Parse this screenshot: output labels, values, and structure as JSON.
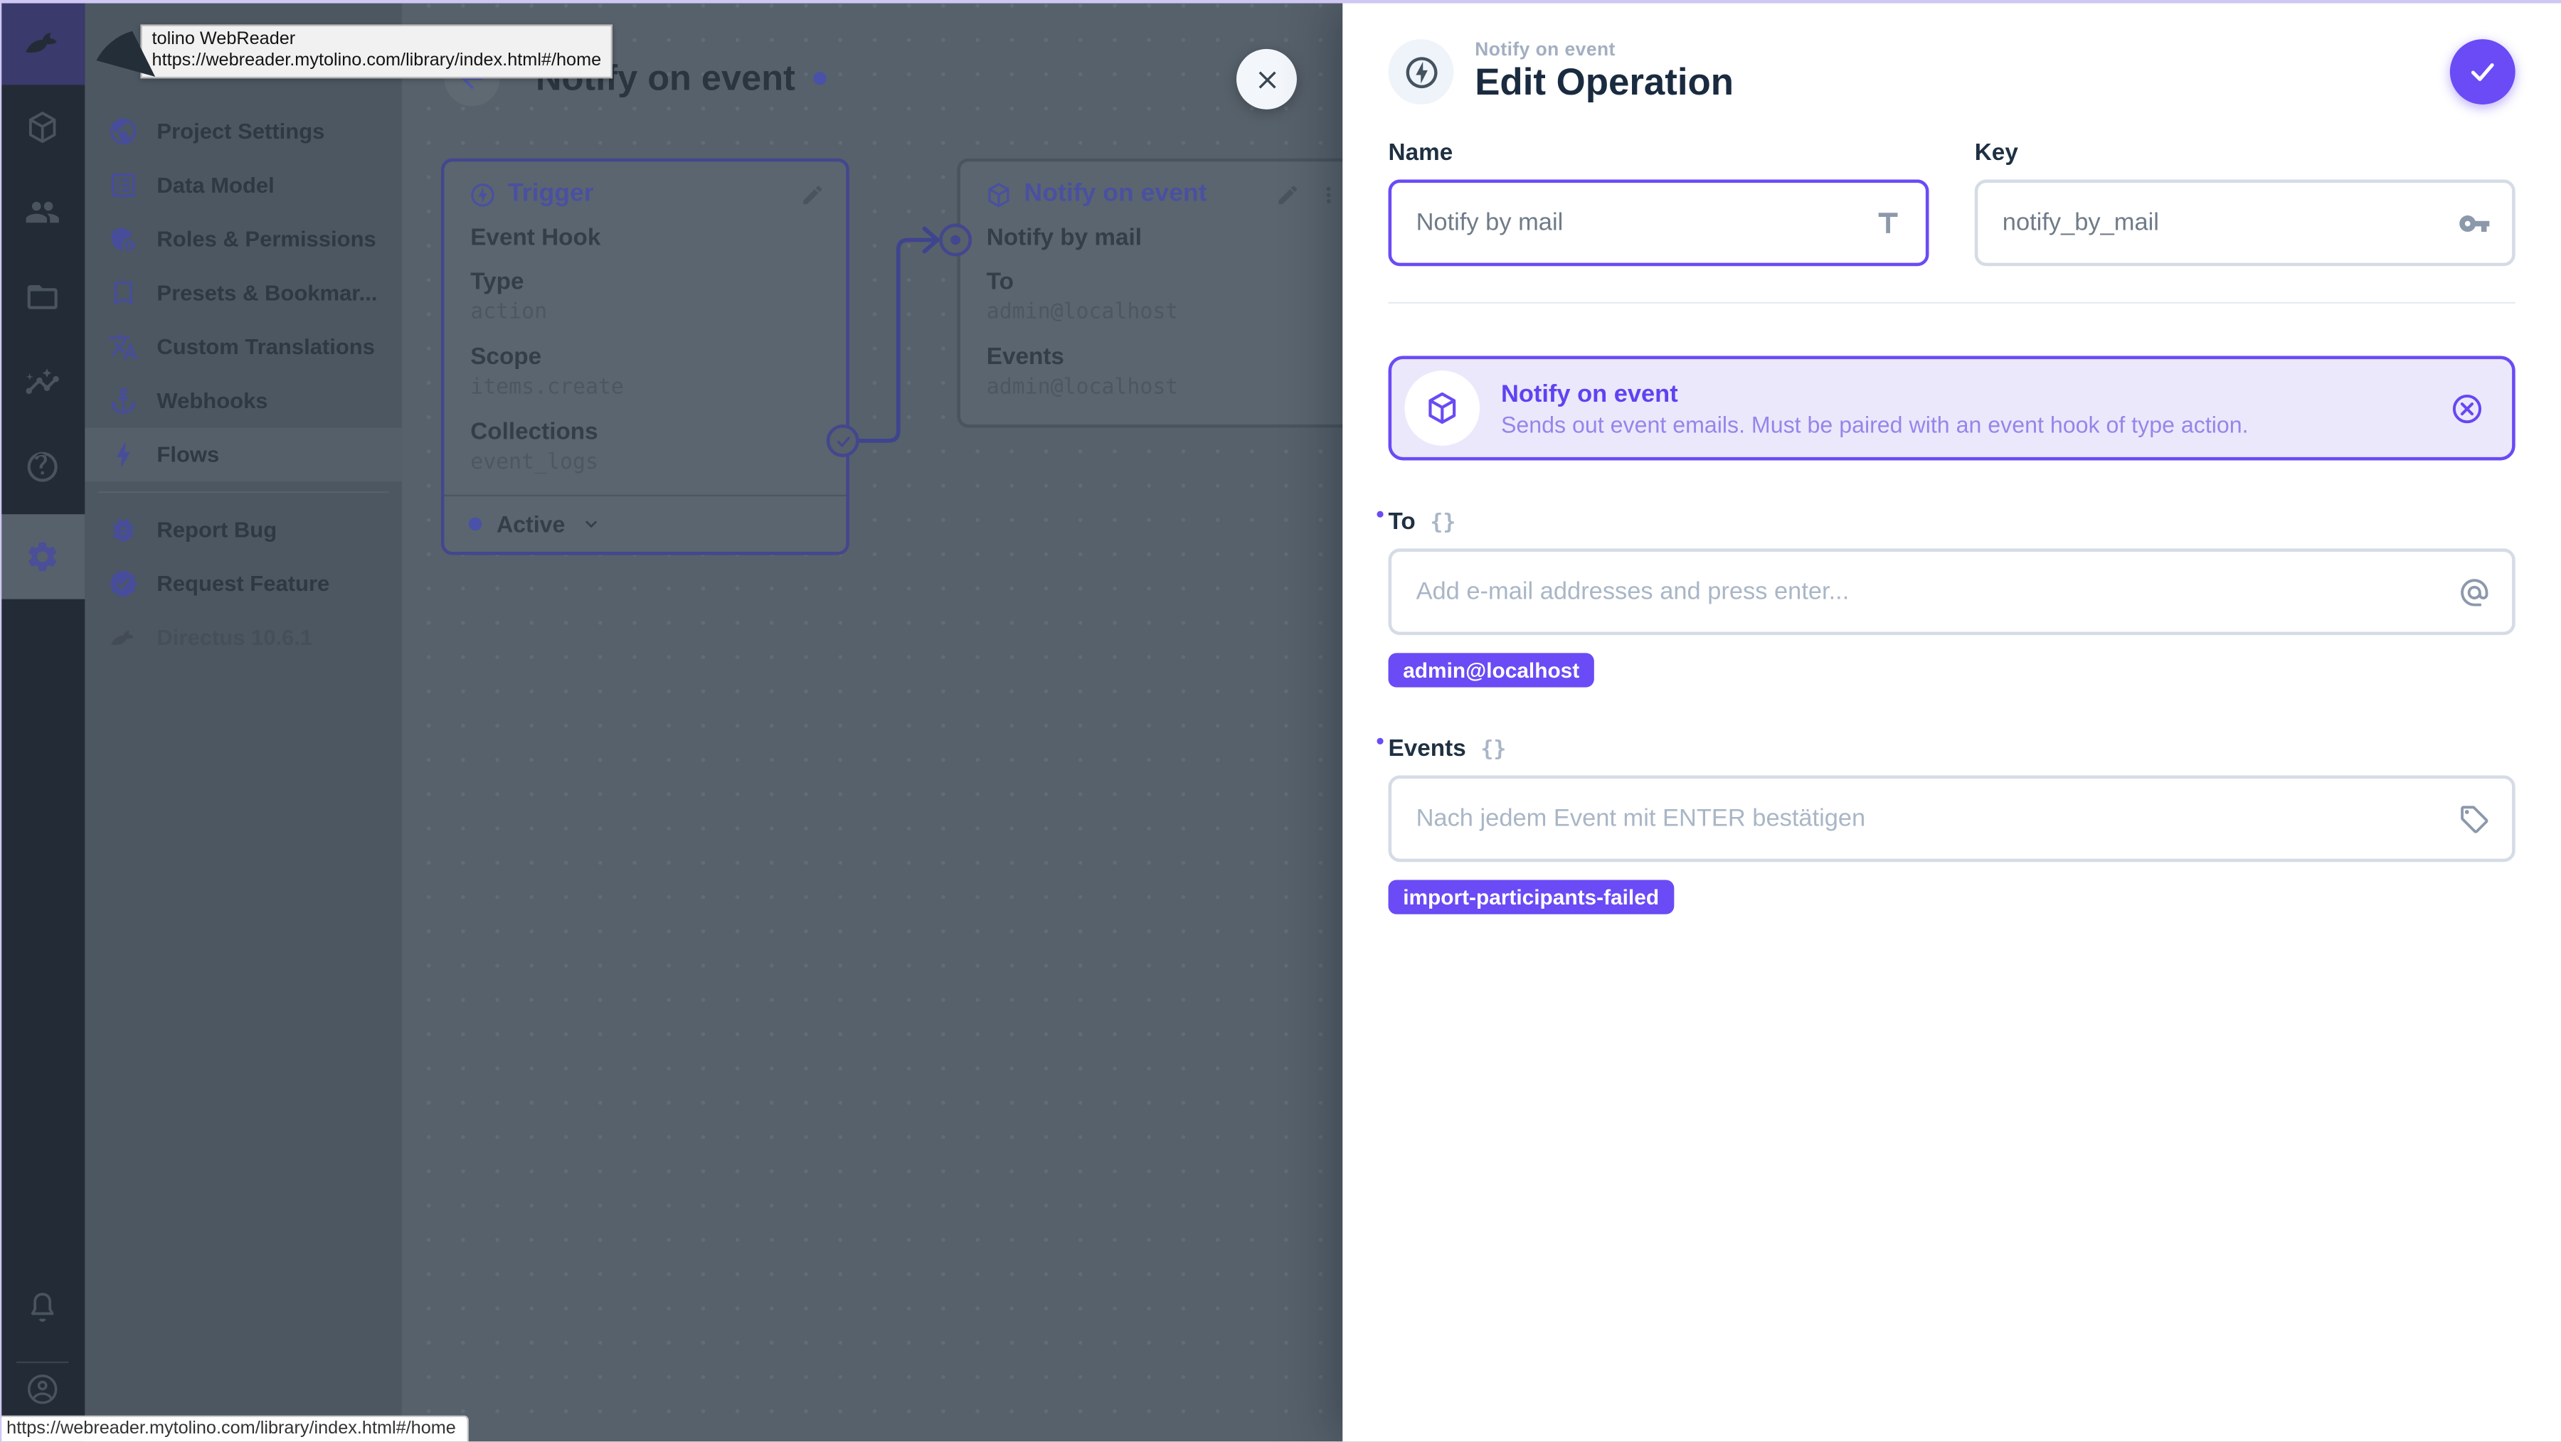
{
  "browser": {
    "tooltip_title": "tolino WebReader",
    "tooltip_url": "https://webreader.mytolino.com/library/index.html#/home",
    "status_url": "https://webreader.mytolino.com/library/index.html#/home"
  },
  "colors": {
    "accent": "#6644FF",
    "pill": "#6A4BF5",
    "notice_bg": "#ECE8FC",
    "dim_canvas": "#57616B"
  },
  "icons": {
    "braces_glyph": "{}",
    "more_vert_glyph": "⋮"
  },
  "module_bar": {
    "icons": [
      "directus-rabbit-logo",
      "content-cube",
      "user-directory",
      "file-library",
      "insights",
      "help",
      "settings-gear",
      "notifications-bell",
      "user-avatar"
    ]
  },
  "nav": {
    "items": [
      {
        "label": "Project Settings"
      },
      {
        "label": "Data Model"
      },
      {
        "label": "Roles & Permissions"
      },
      {
        "label": "Presets & Bookmar..."
      },
      {
        "label": "Custom Translations"
      },
      {
        "label": "Webhooks"
      },
      {
        "label": "Flows"
      }
    ],
    "extra_items": [
      {
        "label": "Report Bug"
      },
      {
        "label": "Request Feature"
      }
    ],
    "version": "Directus 10.6.1"
  },
  "flow": {
    "title": "Notify on event",
    "trigger_card": {
      "header": "Trigger",
      "name": "Event Hook",
      "fields": [
        {
          "label": "Type",
          "value": "action"
        },
        {
          "label": "Scope",
          "value": "items.create"
        },
        {
          "label": "Collections",
          "value": "event_logs"
        }
      ],
      "status": "Active"
    },
    "operation_card": {
      "header": "Notify on event",
      "name": "Notify by mail",
      "fields": [
        {
          "label": "To",
          "value": "admin@localhost"
        },
        {
          "label": "Events",
          "value": "admin@localhost"
        }
      ]
    }
  },
  "drawer": {
    "breadcrumb": "Notify on event",
    "title": "Edit Operation",
    "name": {
      "label": "Name",
      "value": "Notify by mail"
    },
    "key": {
      "label": "Key",
      "value": "notify_by_mail"
    },
    "notice": {
      "title": "Notify on event",
      "description": "Sends out event emails. Must be paired with an event hook of type action."
    },
    "to": {
      "label": "To",
      "placeholder": "Add e-mail addresses and press enter...",
      "tag": "admin@localhost"
    },
    "events": {
      "label": "Events",
      "placeholder": "Nach jedem Event mit ENTER bestätigen",
      "tag": "import-participants-failed"
    }
  }
}
